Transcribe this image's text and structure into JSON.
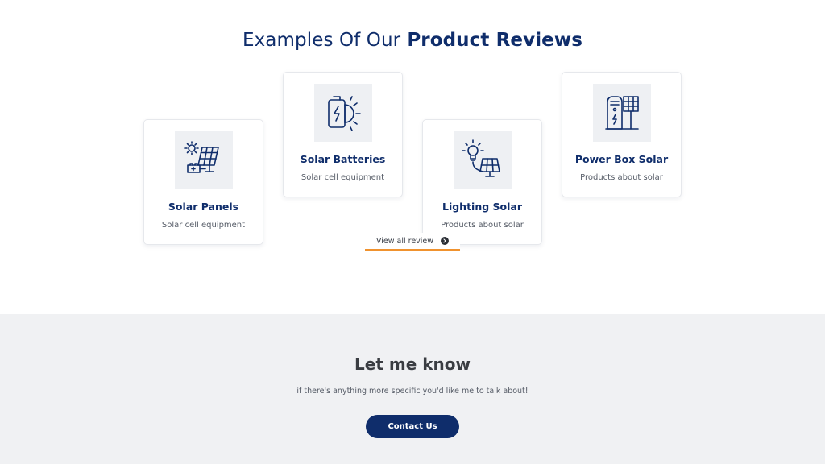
{
  "section": {
    "title_light": "Examples Of Our",
    "title_bold": "Product Reviews"
  },
  "cards": [
    {
      "title": "Solar Panels",
      "subtitle": "Solar cell equipment",
      "icon": "solar-panel-icon"
    },
    {
      "title": "Solar Batteries",
      "subtitle": "Solar cell equipment",
      "icon": "battery-icon"
    },
    {
      "title": "Lighting Solar",
      "subtitle": "Products about solar",
      "icon": "bulb-icon"
    },
    {
      "title": "Power Box Solar",
      "subtitle": "Products about solar",
      "icon": "power-box-icon"
    }
  ],
  "view_all": {
    "label": "View all review",
    "icon": "arrow-circle-icon"
  },
  "contact": {
    "title": "Let me know",
    "subtitle": "if there's anything more specific you'd like me to talk about!",
    "button_label": "Contact Us"
  },
  "colors": {
    "primary": "#0f2d6b",
    "accent": "#f0922e",
    "contact_bg": "#f0f1f3"
  }
}
